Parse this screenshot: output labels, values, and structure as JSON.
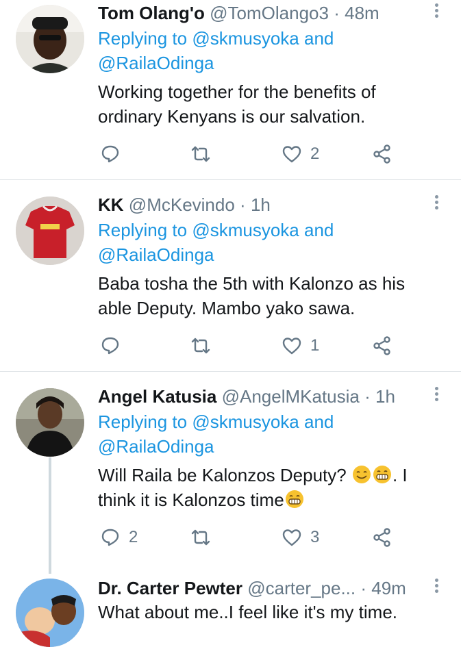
{
  "tweets": [
    {
      "name": "Tom Olang'o",
      "handle": "@TomOlango3",
      "time": "48m",
      "reply_prefix": "Replying to",
      "reply_user1": "@skmusyoka",
      "reply_and": "and",
      "reply_user2": "@RailaOdinga",
      "text_line1": "Working together for the benefits of",
      "text_line2": "ordinary Kenyans is our salvation.",
      "replies": "",
      "retweets": "",
      "likes": "2"
    },
    {
      "name": "KK",
      "handle": "@McKevindo",
      "time": "1h",
      "reply_prefix": "Replying to",
      "reply_user1": "@skmusyoka",
      "reply_and": "and",
      "reply_user2": "@RailaOdinga",
      "text_line1": "Baba tosha the 5th with Kalonzo as his",
      "text_line2": "able Deputy. Mambo yako sawa.",
      "replies": "",
      "retweets": "",
      "likes": "1"
    },
    {
      "name": "Angel Katusia",
      "handle": "@AngelMKatusia",
      "time": "1h",
      "reply_prefix": "Replying to",
      "reply_user1": "@skmusyoka",
      "reply_and": "and",
      "reply_user2": "@RailaOdinga",
      "text_line1": "Will Raila be Kalonzos Deputy?",
      "text_line1_tail": ". I",
      "text_line2": "think it is Kalonzos time",
      "replies": "2",
      "retweets": "",
      "likes": "3"
    },
    {
      "name": "Dr. Carter Pewter",
      "handle": "@carter_pe...",
      "time": "49m",
      "text_line1": "What about me..I feel like it's my time."
    }
  ],
  "separator": "·",
  "colors": {
    "link": "#1b95e0",
    "muted": "#657786",
    "text": "#14171a",
    "divider": "#dfe3e6"
  },
  "icons": [
    "reply-icon",
    "retweet-icon",
    "like-icon",
    "share-icon",
    "more-icon"
  ]
}
